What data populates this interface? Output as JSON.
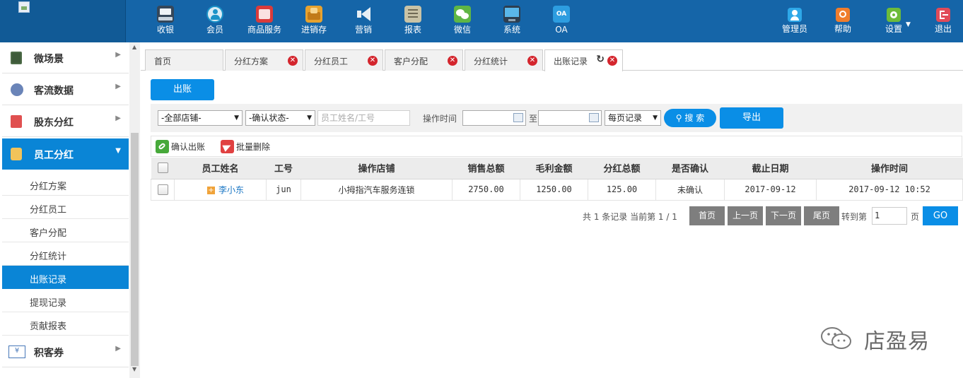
{
  "top_nav": {
    "items": [
      {
        "label": "收银",
        "icon": "cash-register-icon"
      },
      {
        "label": "会员",
        "icon": "member-icon"
      },
      {
        "label": "商品服务",
        "icon": "goods-service-icon"
      },
      {
        "label": "进销存",
        "icon": "inventory-icon"
      },
      {
        "label": "营销",
        "icon": "megaphone-icon"
      },
      {
        "label": "报表",
        "icon": "report-icon"
      },
      {
        "label": "微信",
        "icon": "wechat-icon"
      },
      {
        "label": "系统",
        "icon": "monitor-icon"
      },
      {
        "label": "OA",
        "icon": "oa-icon",
        "icon_text": "OA"
      }
    ],
    "right_items": [
      {
        "label": "管理员",
        "icon": "admin-icon"
      },
      {
        "label": "帮助",
        "icon": "help-icon"
      },
      {
        "label": "设置",
        "icon": "settings-icon"
      },
      {
        "label": "退出",
        "icon": "logout-icon"
      }
    ]
  },
  "sidebar": {
    "groups": [
      {
        "label": "微场景",
        "icon": "phone-icon"
      },
      {
        "label": "客流数据",
        "icon": "traffic-icon"
      },
      {
        "label": "股东分红",
        "icon": "shareholder-icon"
      },
      {
        "label": "员工分红",
        "icon": "staff-icon",
        "expanded": true
      },
      {
        "label": "积客券",
        "icon": "coupon-icon",
        "icon_text": "¥"
      }
    ],
    "subitems": [
      "分红方案",
      "分红员工",
      "客户分配",
      "分红统计",
      "出账记录",
      "提现记录",
      "贡献报表"
    ],
    "active_subitem": "出账记录"
  },
  "tabs": [
    {
      "label": "首页",
      "closable": false
    },
    {
      "label": "分红方案",
      "closable": true
    },
    {
      "label": "分红员工",
      "closable": true
    },
    {
      "label": "客户分配",
      "closable": true
    },
    {
      "label": "分红统计",
      "closable": true
    },
    {
      "label": "出账记录",
      "closable": true,
      "active": true
    }
  ],
  "toolbar": {
    "checkout_label": "出账"
  },
  "filters": {
    "store_select": "-全部店铺-",
    "status_select": "-确认状态-",
    "name_placeholder": "员工姓名/工号",
    "time_label": "操作时间",
    "to_label": "至",
    "per_page_select": "每页记录",
    "search_label": "搜 索",
    "export_label": "导出"
  },
  "actions": {
    "confirm_label": "确认出账",
    "batch_delete_label": "批量删除"
  },
  "table": {
    "columns": [
      "员工姓名",
      "工号",
      "操作店铺",
      "销售总额",
      "毛利金额",
      "分红总额",
      "是否确认",
      "截止日期",
      "操作时间"
    ],
    "rows": [
      {
        "name": "李小东",
        "id": "jun",
        "store": "小拇指汽车服务连锁",
        "sales": "2750.00",
        "gross": "1250.00",
        "bonus": "125.00",
        "confirmed": "未确认",
        "deadline": "2017-09-12",
        "op_time": "2017-09-12 10:52"
      }
    ]
  },
  "pager": {
    "info": "共 1 条记录 当前第 1 / 1",
    "first": "首页",
    "prev": "上一页",
    "next": "下一页",
    "last": "尾页",
    "jump_label": "转到第",
    "jump_value": "1",
    "page_label": "页",
    "go": "GO"
  },
  "watermark": {
    "text": "店盈易",
    "icon": "wechat-icon"
  },
  "colors": {
    "topbar": "#1565a8",
    "accent": "#0a85d6",
    "close_badge": "#d4262e"
  }
}
